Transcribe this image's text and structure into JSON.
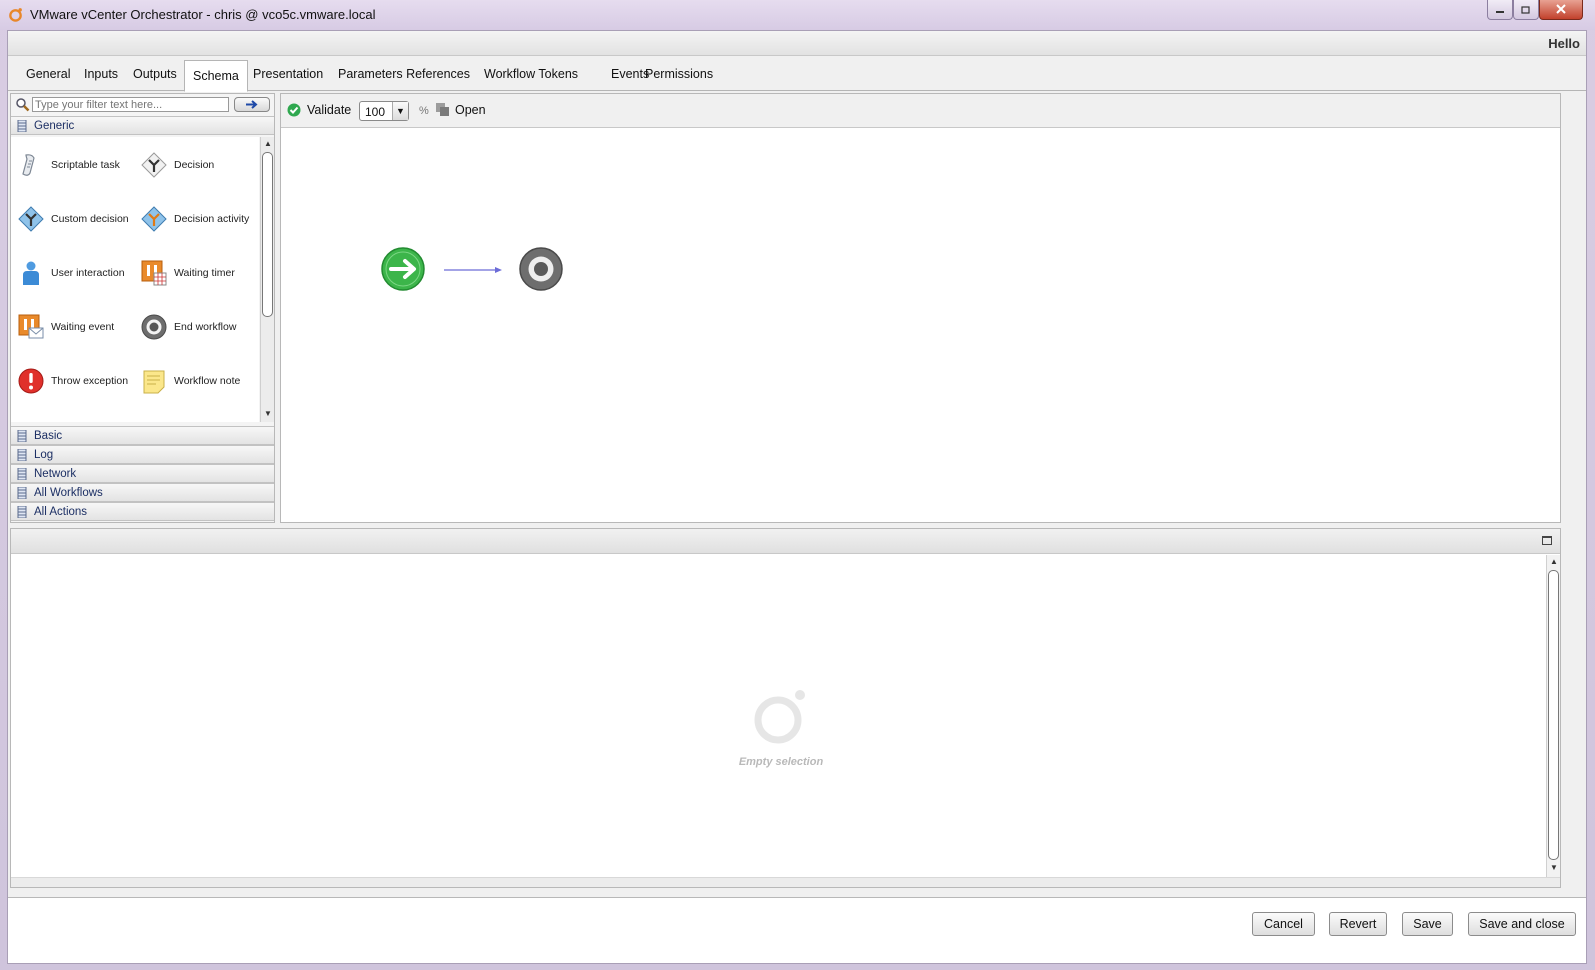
{
  "window": {
    "title": "VMware vCenter Orchestrator - chris @ vco5c.vmware.local",
    "greeting": "Hello"
  },
  "tabs": [
    {
      "label": "General"
    },
    {
      "label": "Inputs"
    },
    {
      "label": "Outputs"
    },
    {
      "label": "Schema",
      "active": true
    },
    {
      "label": "Presentation"
    },
    {
      "label": "Parameters References"
    },
    {
      "label": "Workflow Tokens"
    },
    {
      "label": "Events"
    },
    {
      "label": "Permissions"
    }
  ],
  "palette": {
    "filter_placeholder": "Type your filter text here...",
    "categories": [
      {
        "label": "Generic",
        "expanded": true
      },
      {
        "label": "Basic"
      },
      {
        "label": "Log"
      },
      {
        "label": "Network"
      },
      {
        "label": "All Workflows"
      },
      {
        "label": "All Actions"
      }
    ],
    "items": [
      {
        "label": "Scriptable task",
        "icon": "scriptable-task-icon"
      },
      {
        "label": "Decision",
        "icon": "decision-icon"
      },
      {
        "label": "Custom decision",
        "icon": "custom-decision-icon"
      },
      {
        "label": "Decision activity",
        "icon": "decision-activity-icon"
      },
      {
        "label": "User interaction",
        "icon": "user-interaction-icon"
      },
      {
        "label": "Waiting timer",
        "icon": "waiting-timer-icon"
      },
      {
        "label": "Waiting event",
        "icon": "waiting-event-icon"
      },
      {
        "label": "End workflow",
        "icon": "end-workflow-icon"
      },
      {
        "label": "Throw exception",
        "icon": "throw-exception-icon"
      },
      {
        "label": "Workflow note",
        "icon": "workflow-note-icon"
      }
    ]
  },
  "toolbar": {
    "validate_label": "Validate",
    "zoom_value": "100",
    "zoom_unit": "%",
    "open_label": "Open"
  },
  "details": {
    "empty_label": "Empty selection"
  },
  "buttons": {
    "cancel": "Cancel",
    "revert": "Revert",
    "save": "Save",
    "save_close": "Save and close"
  },
  "colors": {
    "start_green": "#3cb54a",
    "end_gray": "#6e6e6e",
    "connector": "#6c6cd8",
    "title_bar": "#e3d9ed"
  }
}
